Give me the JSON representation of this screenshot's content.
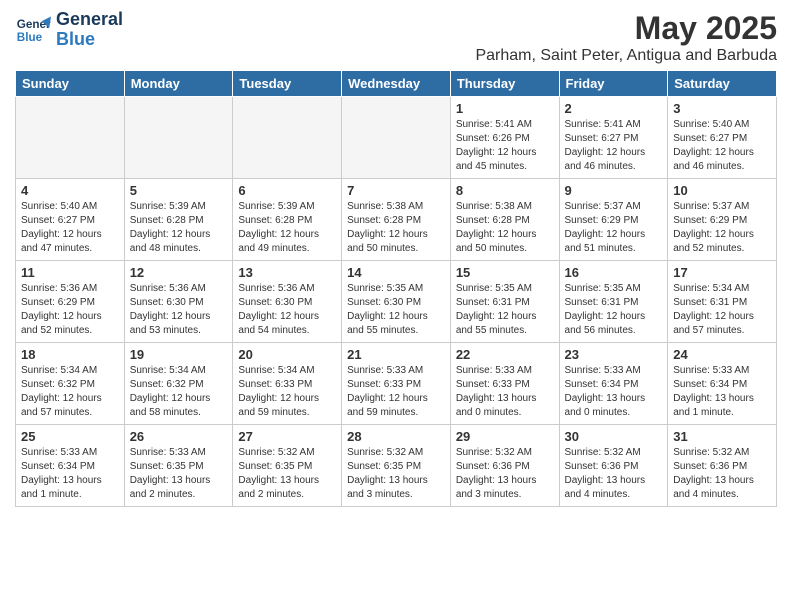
{
  "header": {
    "logo_line1": "General",
    "logo_line2": "Blue",
    "month": "May 2025",
    "location": "Parham, Saint Peter, Antigua and Barbuda"
  },
  "days_of_week": [
    "Sunday",
    "Monday",
    "Tuesday",
    "Wednesday",
    "Thursday",
    "Friday",
    "Saturday"
  ],
  "weeks": [
    [
      {
        "day": "",
        "empty": true
      },
      {
        "day": "",
        "empty": true
      },
      {
        "day": "",
        "empty": true
      },
      {
        "day": "",
        "empty": true
      },
      {
        "day": "1",
        "sunrise": "5:41 AM",
        "sunset": "6:26 PM",
        "daylight": "12 hours and 45 minutes."
      },
      {
        "day": "2",
        "sunrise": "5:41 AM",
        "sunset": "6:27 PM",
        "daylight": "12 hours and 46 minutes."
      },
      {
        "day": "3",
        "sunrise": "5:40 AM",
        "sunset": "6:27 PM",
        "daylight": "12 hours and 46 minutes."
      }
    ],
    [
      {
        "day": "4",
        "sunrise": "5:40 AM",
        "sunset": "6:27 PM",
        "daylight": "12 hours and 47 minutes."
      },
      {
        "day": "5",
        "sunrise": "5:39 AM",
        "sunset": "6:28 PM",
        "daylight": "12 hours and 48 minutes."
      },
      {
        "day": "6",
        "sunrise": "5:39 AM",
        "sunset": "6:28 PM",
        "daylight": "12 hours and 49 minutes."
      },
      {
        "day": "7",
        "sunrise": "5:38 AM",
        "sunset": "6:28 PM",
        "daylight": "12 hours and 50 minutes."
      },
      {
        "day": "8",
        "sunrise": "5:38 AM",
        "sunset": "6:28 PM",
        "daylight": "12 hours and 50 minutes."
      },
      {
        "day": "9",
        "sunrise": "5:37 AM",
        "sunset": "6:29 PM",
        "daylight": "12 hours and 51 minutes."
      },
      {
        "day": "10",
        "sunrise": "5:37 AM",
        "sunset": "6:29 PM",
        "daylight": "12 hours and 52 minutes."
      }
    ],
    [
      {
        "day": "11",
        "sunrise": "5:36 AM",
        "sunset": "6:29 PM",
        "daylight": "12 hours and 52 minutes."
      },
      {
        "day": "12",
        "sunrise": "5:36 AM",
        "sunset": "6:30 PM",
        "daylight": "12 hours and 53 minutes."
      },
      {
        "day": "13",
        "sunrise": "5:36 AM",
        "sunset": "6:30 PM",
        "daylight": "12 hours and 54 minutes."
      },
      {
        "day": "14",
        "sunrise": "5:35 AM",
        "sunset": "6:30 PM",
        "daylight": "12 hours and 55 minutes."
      },
      {
        "day": "15",
        "sunrise": "5:35 AM",
        "sunset": "6:31 PM",
        "daylight": "12 hours and 55 minutes."
      },
      {
        "day": "16",
        "sunrise": "5:35 AM",
        "sunset": "6:31 PM",
        "daylight": "12 hours and 56 minutes."
      },
      {
        "day": "17",
        "sunrise": "5:34 AM",
        "sunset": "6:31 PM",
        "daylight": "12 hours and 57 minutes."
      }
    ],
    [
      {
        "day": "18",
        "sunrise": "5:34 AM",
        "sunset": "6:32 PM",
        "daylight": "12 hours and 57 minutes."
      },
      {
        "day": "19",
        "sunrise": "5:34 AM",
        "sunset": "6:32 PM",
        "daylight": "12 hours and 58 minutes."
      },
      {
        "day": "20",
        "sunrise": "5:34 AM",
        "sunset": "6:33 PM",
        "daylight": "12 hours and 59 minutes."
      },
      {
        "day": "21",
        "sunrise": "5:33 AM",
        "sunset": "6:33 PM",
        "daylight": "12 hours and 59 minutes."
      },
      {
        "day": "22",
        "sunrise": "5:33 AM",
        "sunset": "6:33 PM",
        "daylight": "13 hours and 0 minutes."
      },
      {
        "day": "23",
        "sunrise": "5:33 AM",
        "sunset": "6:34 PM",
        "daylight": "13 hours and 0 minutes."
      },
      {
        "day": "24",
        "sunrise": "5:33 AM",
        "sunset": "6:34 PM",
        "daylight": "13 hours and 1 minute."
      }
    ],
    [
      {
        "day": "25",
        "sunrise": "5:33 AM",
        "sunset": "6:34 PM",
        "daylight": "13 hours and 1 minute."
      },
      {
        "day": "26",
        "sunrise": "5:33 AM",
        "sunset": "6:35 PM",
        "daylight": "13 hours and 2 minutes."
      },
      {
        "day": "27",
        "sunrise": "5:32 AM",
        "sunset": "6:35 PM",
        "daylight": "13 hours and 2 minutes."
      },
      {
        "day": "28",
        "sunrise": "5:32 AM",
        "sunset": "6:35 PM",
        "daylight": "13 hours and 3 minutes."
      },
      {
        "day": "29",
        "sunrise": "5:32 AM",
        "sunset": "6:36 PM",
        "daylight": "13 hours and 3 minutes."
      },
      {
        "day": "30",
        "sunrise": "5:32 AM",
        "sunset": "6:36 PM",
        "daylight": "13 hours and 4 minutes."
      },
      {
        "day": "31",
        "sunrise": "5:32 AM",
        "sunset": "6:36 PM",
        "daylight": "13 hours and 4 minutes."
      }
    ]
  ]
}
